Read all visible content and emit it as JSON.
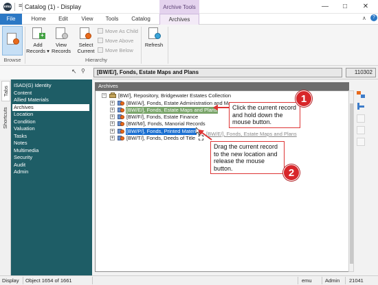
{
  "titlebar": {
    "logo_text": "emu",
    "title": "Catalog (1) - Display",
    "context_group": "Archive Tools",
    "qat": "≡",
    "window_buttons": [
      "—",
      "□",
      "✕"
    ]
  },
  "ribbon_tabs": [
    {
      "label": "File"
    },
    {
      "label": "Home"
    },
    {
      "label": "Edit"
    },
    {
      "label": "View"
    },
    {
      "label": "Tools"
    },
    {
      "label": "Catalog"
    },
    {
      "label": "Archives"
    }
  ],
  "ribbon": {
    "collapse": "∧",
    "help": "?",
    "browse_group": "Browse",
    "hierarchy_group": "Hierarchy",
    "add_records": "Add\nRecords ▾",
    "view_records": "View\nRecords",
    "select_current": "Select\nCurrent",
    "move_as_child": "Move As Child",
    "move_above": "Move Above",
    "move_below": "Move Below",
    "refresh": "Refresh"
  },
  "pathbar": {
    "path": "[BW/E/], Fonds, Estate Maps and Plans",
    "record_id": "110302"
  },
  "side_tabs": [
    "Tabs",
    "Shortcuts"
  ],
  "nav_items": [
    {
      "label": "ISAD(G) Identity",
      "selected": false
    },
    {
      "label": "Content",
      "selected": false
    },
    {
      "label": "Allied Materials",
      "selected": false
    },
    {
      "label": "Archives",
      "selected": true
    },
    {
      "label": "Location",
      "selected": false
    },
    {
      "label": "Condition",
      "selected": false
    },
    {
      "label": "Valuation",
      "selected": false
    },
    {
      "label": "Tasks",
      "selected": false
    },
    {
      "label": "Notes",
      "selected": false
    },
    {
      "label": "Multimedia",
      "selected": false
    },
    {
      "label": "Security",
      "selected": false
    },
    {
      "label": "Audit",
      "selected": false
    },
    {
      "label": "Admin",
      "selected": false
    }
  ],
  "main": {
    "header": "Archives",
    "tree": {
      "root": "[BW/], Repository, Bridgewater Estates Collection",
      "children": [
        {
          "label": "[BW/A/], Fonds, Estate Administration and Ma",
          "highlight": "none"
        },
        {
          "label": "[BW/E/], Fonds, Estate Maps and Plans",
          "highlight": "green"
        },
        {
          "label": "[BW/F/], Fonds, Estate Finance",
          "highlight": "none"
        },
        {
          "label": "[BW/M/], Fonds, Manorial Records",
          "highlight": "none"
        },
        {
          "label": "[BW/P/], Fonds, Printed Materi",
          "highlight": "blue"
        },
        {
          "label": "[BW/T/], Fonds, Deeds of Title",
          "highlight": "none"
        }
      ],
      "drag_ghost": "[BW/E/], Fonds, Estate Maps and Plans"
    },
    "callout_1": {
      "number": "1",
      "text": "Click the current record and hold down the mouse button."
    },
    "callout_2": {
      "number": "2",
      "text": "Drag the current record to the new location and release the mouse button."
    }
  },
  "statusbar": {
    "mode": "Display",
    "object_count": "Object 1654 of 1661",
    "user": "emu",
    "group": "Admin",
    "number": "21041"
  },
  "colors": {
    "file_tab": "#2b78c5",
    "nav_panel": "#1e5d66",
    "callout_accent": "#d8262a",
    "context_tab": "#e4d3ee",
    "drag_target": "#1a6fd1",
    "source_highlight": "#7aa56a"
  }
}
